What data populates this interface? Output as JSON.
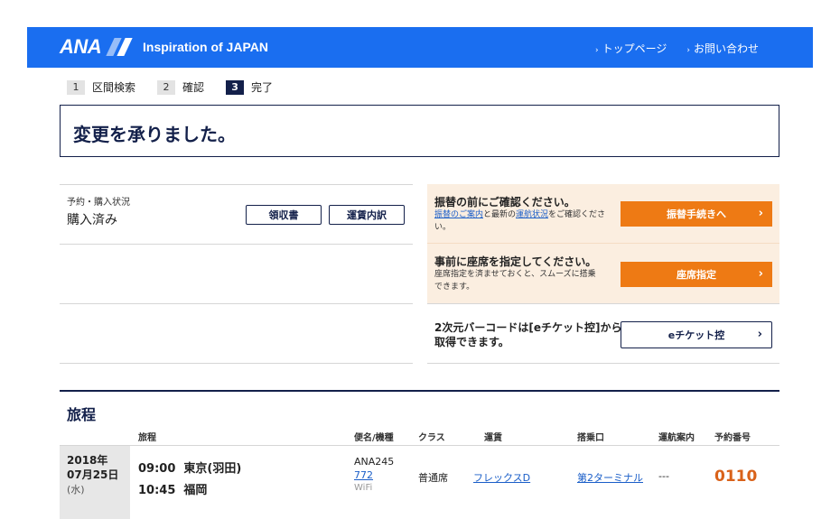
{
  "header": {
    "logo": "ANA",
    "tagline": "Inspiration of JAPAN",
    "nav": [
      "トップページ",
      "お問い合わせ"
    ],
    "brand_color": "#1a6ef0"
  },
  "steps": [
    {
      "num": "1",
      "label": "区間検索"
    },
    {
      "num": "2",
      "label": "確認"
    },
    {
      "num": "3",
      "label": "完了",
      "active": true
    }
  ],
  "completion_message": "変更を承りました。",
  "purchase": {
    "label": "予約・購入状況",
    "value": "購入済み",
    "receipt_button": "領収書",
    "fare_breakdown_button": "運賃内訳"
  },
  "notices": {
    "change": {
      "title": "振替の前にご確認ください。",
      "note_link1": "振替のご案内",
      "note_mid": "と最新の",
      "note_link2": "運航状況",
      "note_end": "をご確認ください。",
      "button": "振替手続きへ"
    },
    "seat": {
      "title": "事前に座席を指定してください。",
      "note": "座席指定を済ませておくと、スムーズに搭乗できます。",
      "button": "座席指定"
    },
    "eticket": {
      "title": "2次元バーコードは[eチケット控]から取得できます。",
      "button": "eチケット控"
    },
    "accent_color": "#ee7a14"
  },
  "itinerary": {
    "title": "旅程",
    "columns": [
      "旅程",
      "便名/機種",
      "クラス",
      "運賃",
      "搭乗口",
      "運航案内",
      "予約番号"
    ],
    "row": {
      "date": "2018年\n07月25日",
      "weekday": "(水)",
      "departure": "09:00  東京(羽田)",
      "arrival": "10:45  福岡",
      "flight": "ANA245",
      "aircraft": "772",
      "wifi": "WiFi",
      "class": "普通席",
      "fare": "フレックスD",
      "gate": "第2ターミナル",
      "ops": "---",
      "reservation": "0110"
    }
  }
}
